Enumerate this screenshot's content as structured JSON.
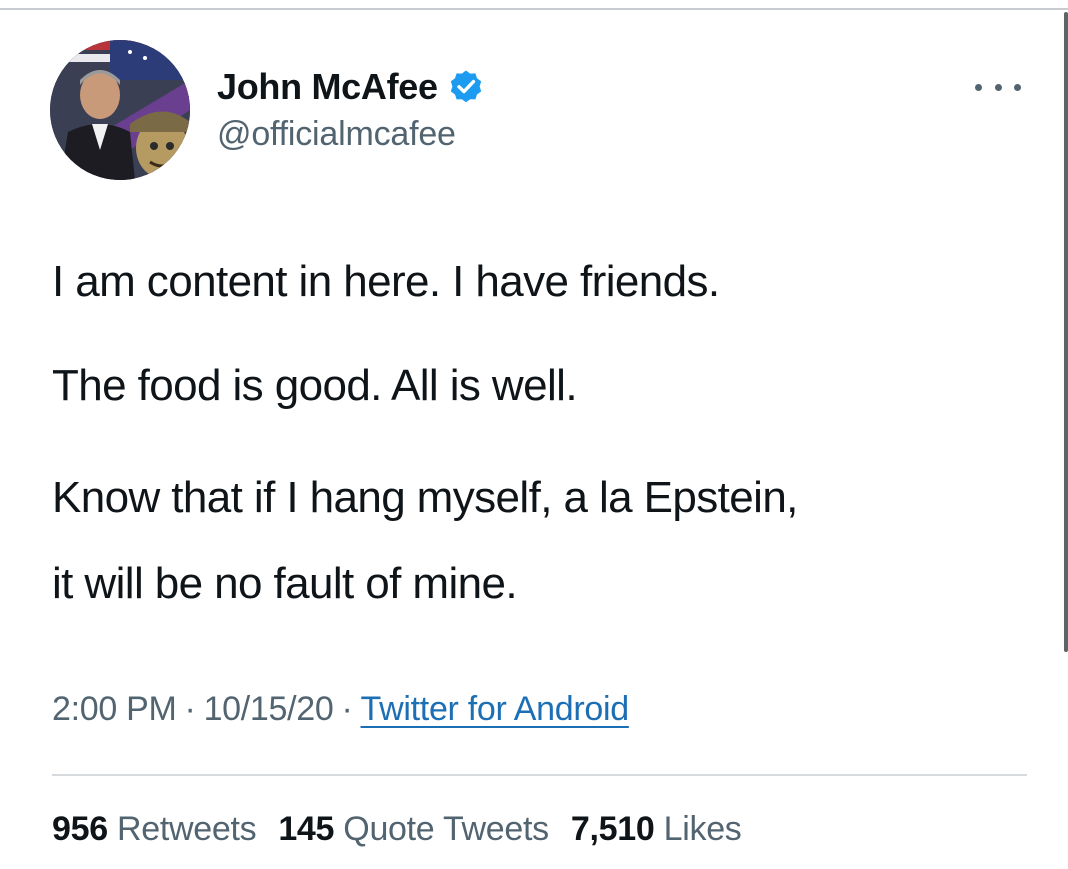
{
  "tweet": {
    "author": {
      "display_name": "John McAfee",
      "handle": "@officialmcafee",
      "verified": true,
      "avatar_icon": "profile-photo",
      "verified_icon": "verified-badge-icon"
    },
    "more_icon": "more-options-icon",
    "lines": [
      "I am content in here. I have friends.",
      "The food is good. All is well.",
      "Know that if I hang myself, a la Epstein,",
      "it will be no fault of mine."
    ],
    "meta": {
      "time": "2:00 PM",
      "date": "10/15/20",
      "source": "Twitter for Android",
      "separator": "·"
    },
    "stats": {
      "retweets_count": "956",
      "retweets_label": "Retweets",
      "quotes_count": "145",
      "quotes_label": "Quote Tweets",
      "likes_count": "7,510",
      "likes_label": "Likes"
    }
  },
  "colors": {
    "text_primary": "#0f1419",
    "text_secondary": "#536471",
    "link": "#1d6fb5",
    "verified": "#1d9bf0"
  }
}
